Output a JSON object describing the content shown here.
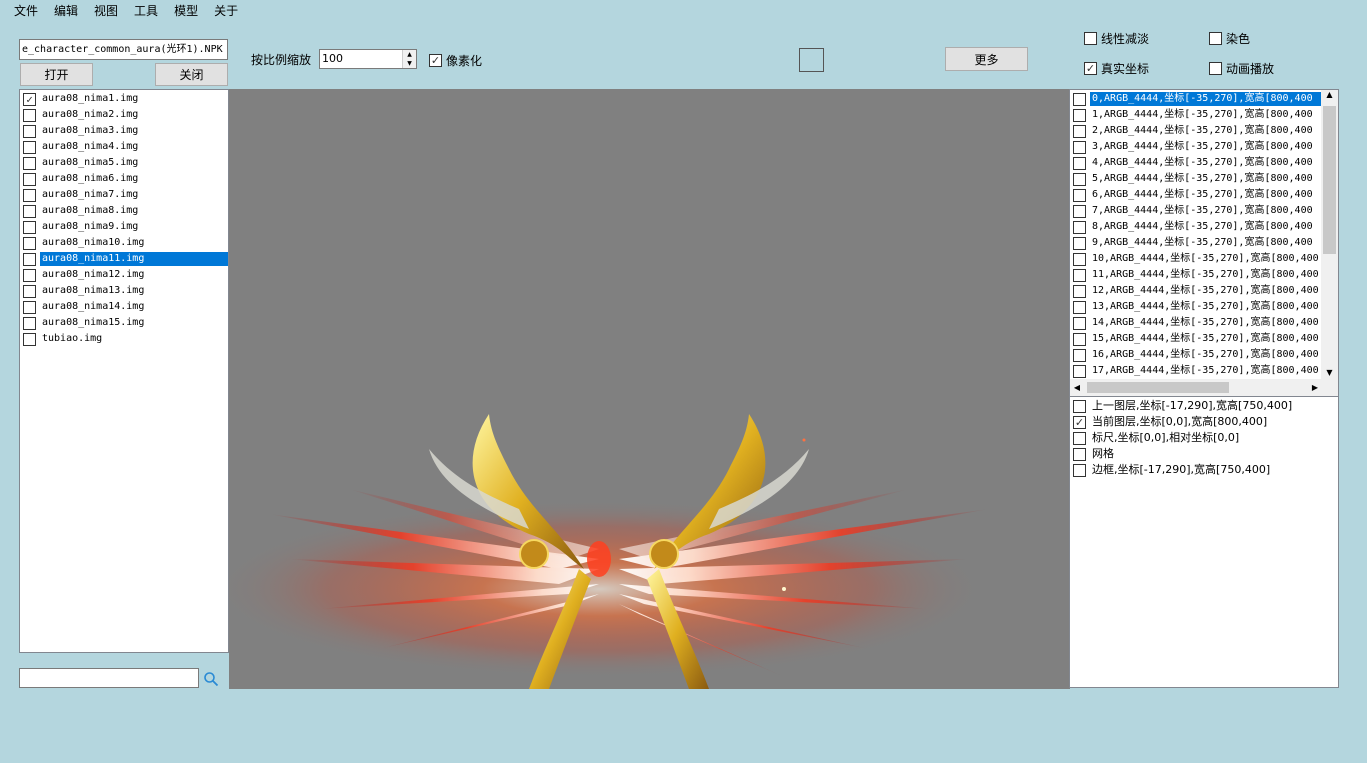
{
  "menu": [
    "文件",
    "编辑",
    "视图",
    "工具",
    "模型",
    "关于"
  ],
  "file": {
    "name": "e_character_common_aura(光环1).NPK",
    "open_label": "打开",
    "close_label": "关闭"
  },
  "toolbar": {
    "scale_label": "按比例缩放",
    "scale_value": "100",
    "pixelate_label": "像素化",
    "more_label": "更多"
  },
  "options": {
    "linear_fade": "线性减淡",
    "dye": "染色",
    "real_coords": "真实坐标",
    "anim_play": "动画播放"
  },
  "img_list": [
    {
      "name": "aura08_nima1.img",
      "checked": true
    },
    {
      "name": "aura08_nima2.img",
      "checked": false
    },
    {
      "name": "aura08_nima3.img",
      "checked": false
    },
    {
      "name": "aura08_nima4.img",
      "checked": false
    },
    {
      "name": "aura08_nima5.img",
      "checked": false
    },
    {
      "name": "aura08_nima6.img",
      "checked": false
    },
    {
      "name": "aura08_nima7.img",
      "checked": false
    },
    {
      "name": "aura08_nima8.img",
      "checked": false
    },
    {
      "name": "aura08_nima9.img",
      "checked": false
    },
    {
      "name": "aura08_nima10.img",
      "checked": false
    },
    {
      "name": "aura08_nima11.img",
      "checked": false,
      "selected": true
    },
    {
      "name": "aura08_nima12.img",
      "checked": false
    },
    {
      "name": "aura08_nima13.img",
      "checked": false
    },
    {
      "name": "aura08_nima14.img",
      "checked": false
    },
    {
      "name": "aura08_nima15.img",
      "checked": false
    },
    {
      "name": "tubiao.img",
      "checked": false
    }
  ],
  "frames": [
    "0,ARGB_4444,坐标[-35,270],宽高[800,400",
    "1,ARGB_4444,坐标[-35,270],宽高[800,400",
    "2,ARGB_4444,坐标[-35,270],宽高[800,400",
    "3,ARGB_4444,坐标[-35,270],宽高[800,400",
    "4,ARGB_4444,坐标[-35,270],宽高[800,400",
    "5,ARGB_4444,坐标[-35,270],宽高[800,400",
    "6,ARGB_4444,坐标[-35,270],宽高[800,400",
    "7,ARGB_4444,坐标[-35,270],宽高[800,400",
    "8,ARGB_4444,坐标[-35,270],宽高[800,400",
    "9,ARGB_4444,坐标[-35,270],宽高[800,400",
    "10,ARGB_4444,坐标[-35,270],宽高[800,400",
    "11,ARGB_4444,坐标[-35,270],宽高[800,400",
    "12,ARGB_4444,坐标[-35,270],宽高[800,400",
    "13,ARGB_4444,坐标[-35,270],宽高[800,400",
    "14,ARGB_4444,坐标[-35,270],宽高[800,400",
    "15,ARGB_4444,坐标[-35,270],宽高[800,400",
    "16,ARGB_4444,坐标[-35,270],宽高[800,400",
    "17,ARGB_4444,坐标[-35,270],宽高[800,400"
  ],
  "layers": [
    {
      "label": "上一图层,坐标[-17,290],宽高[750,400]",
      "checked": false
    },
    {
      "label": "当前图层,坐标[0,0],宽高[800,400]",
      "checked": true
    },
    {
      "label": "标尺,坐标[0,0],相对坐标[0,0]",
      "checked": false
    },
    {
      "label": "网格",
      "checked": false
    },
    {
      "label": "边框,坐标[-17,290],宽高[750,400]",
      "checked": false
    }
  ],
  "search": {
    "placeholder": ""
  },
  "icons": {
    "search": "search-icon"
  }
}
